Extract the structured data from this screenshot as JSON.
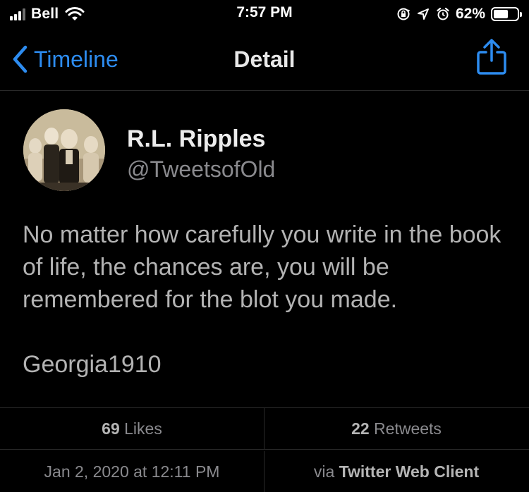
{
  "status_bar": {
    "carrier": "Bell",
    "time": "7:57 PM",
    "battery_percent": "62%",
    "battery_level": 0.62,
    "icons": [
      "signal-icon",
      "wifi-icon",
      "orientation-lock-icon",
      "location-arrow-icon",
      "alarm-icon",
      "battery-icon"
    ]
  },
  "nav": {
    "back_label": "Timeline",
    "title": "Detail",
    "share_icon": "share-icon"
  },
  "tweet": {
    "author_name": "R.L. Ripples",
    "author_handle": "@TweetsofOld",
    "text": "No matter how carefully you write in the book of life, the chances are, you will be remembered for the blot you made.",
    "signature": "Georgia1910",
    "likes_count": "69",
    "likes_label": "Likes",
    "retweets_count": "22",
    "retweets_label": "Retweets",
    "date": "Jan 2, 2020 at 12:11 PM",
    "via_prefix": "via",
    "client": "Twitter Web Client"
  },
  "colors": {
    "background": "#000000",
    "accent": "#2d8cf0",
    "primary_text": "#ececec",
    "secondary_text": "#8a8a8e",
    "body_text": "#b3b3b3",
    "divider": "#2a2a2a"
  }
}
